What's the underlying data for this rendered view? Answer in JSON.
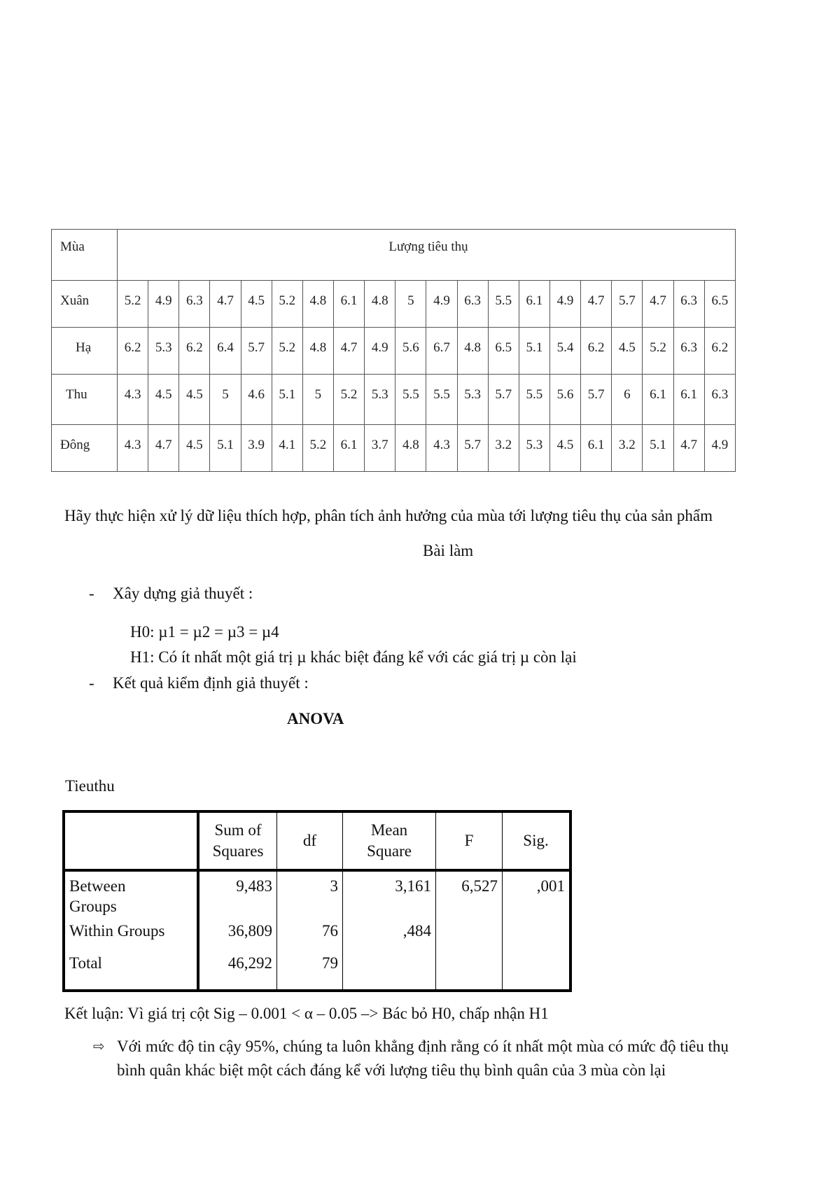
{
  "data_table": {
    "header_season": "Mùa",
    "header_values": "Lượng tiêu thụ",
    "rows": [
      {
        "season": "Xuân",
        "values": [
          "5.2",
          "4.9",
          "6.3",
          "4.7",
          "4.5",
          "5.2",
          "4.8",
          "6.1",
          "4.8",
          "5",
          "4.9",
          "6.3",
          "5.5",
          "6.1",
          "4.9",
          "4.7",
          "5.7",
          "4.7",
          "6.3",
          "6.5"
        ]
      },
      {
        "season": "Hạ",
        "values": [
          "6.2",
          "5.3",
          "6.2",
          "6.4",
          "5.7",
          "5.2",
          "4.8",
          "4.7",
          "4.9",
          "5.6",
          "6.7",
          "4.8",
          "6.5",
          "5.1",
          "5.4",
          "6.2",
          "4.5",
          "5.2",
          "6.3",
          "6.2"
        ]
      },
      {
        "season": "Thu",
        "values": [
          "4.3",
          "4.5",
          "4.5",
          "5",
          "4.6",
          "5.1",
          "5",
          "5.2",
          "5.3",
          "5.5",
          "5.5",
          "5.3",
          "5.7",
          "5.5",
          "5.6",
          "5.7",
          "6",
          "6.1",
          "6.1",
          "6.3"
        ]
      },
      {
        "season": "Đông",
        "values": [
          "4.3",
          "4.7",
          "4.5",
          "5.1",
          "3.9",
          "4.1",
          "5.2",
          "6.1",
          "3.7",
          "4.8",
          "4.3",
          "5.7",
          "3.2",
          "5.3",
          "4.5",
          "6.1",
          "3.2",
          "5.1",
          "4.7",
          "4.9"
        ]
      }
    ]
  },
  "task": "Hãy thực hiện xử lý dữ liệu thích hợp, phân tích ảnh hưởng của mùa tới lượng tiêu thụ của sản phẩm",
  "solution_title": "Bài làm",
  "bullet_dash": "-",
  "hypothesis_heading": "Xây dựng giả thuyết :",
  "h0": "H0: µ1 = µ2 = µ3 = µ4",
  "h1": "H1: Có ít nhất một giá trị µ khác biệt đáng kể với các giá trị µ còn lại",
  "result_heading": "Kết quả kiểm định giả thuyết :",
  "anova": {
    "title": "ANOVA",
    "variable": "Tieuthu",
    "headers": [
      "",
      "Sum of Squares",
      "df",
      "Mean Square",
      "F",
      "Sig."
    ],
    "rows": [
      {
        "label": "Between Groups",
        "ss": "9,483",
        "df": "3",
        "ms": "3,161",
        "f": "6,527",
        "sig": ",001"
      },
      {
        "label": "Within Groups",
        "ss": "36,809",
        "df": "76",
        "ms": ",484",
        "f": "",
        "sig": ""
      },
      {
        "label": "Total",
        "ss": "46,292",
        "df": "79",
        "ms": "",
        "f": "",
        "sig": ""
      }
    ]
  },
  "conclusion": "Kết luận: Vì giá trị cột Sig – 0.001 < α – 0.05 –> Bác bỏ H0, chấp nhận H1",
  "arrow_glyph": "⇨",
  "final_line1": "Với mức độ tin cậy 95%, chúng ta luôn khẳng định rằng có ít nhất một mùa có mức độ tiêu thụ",
  "final_line2": "bình quân khác biệt một cách đáng kể với lượng tiêu thụ bình quân của 3 mùa còn lại"
}
